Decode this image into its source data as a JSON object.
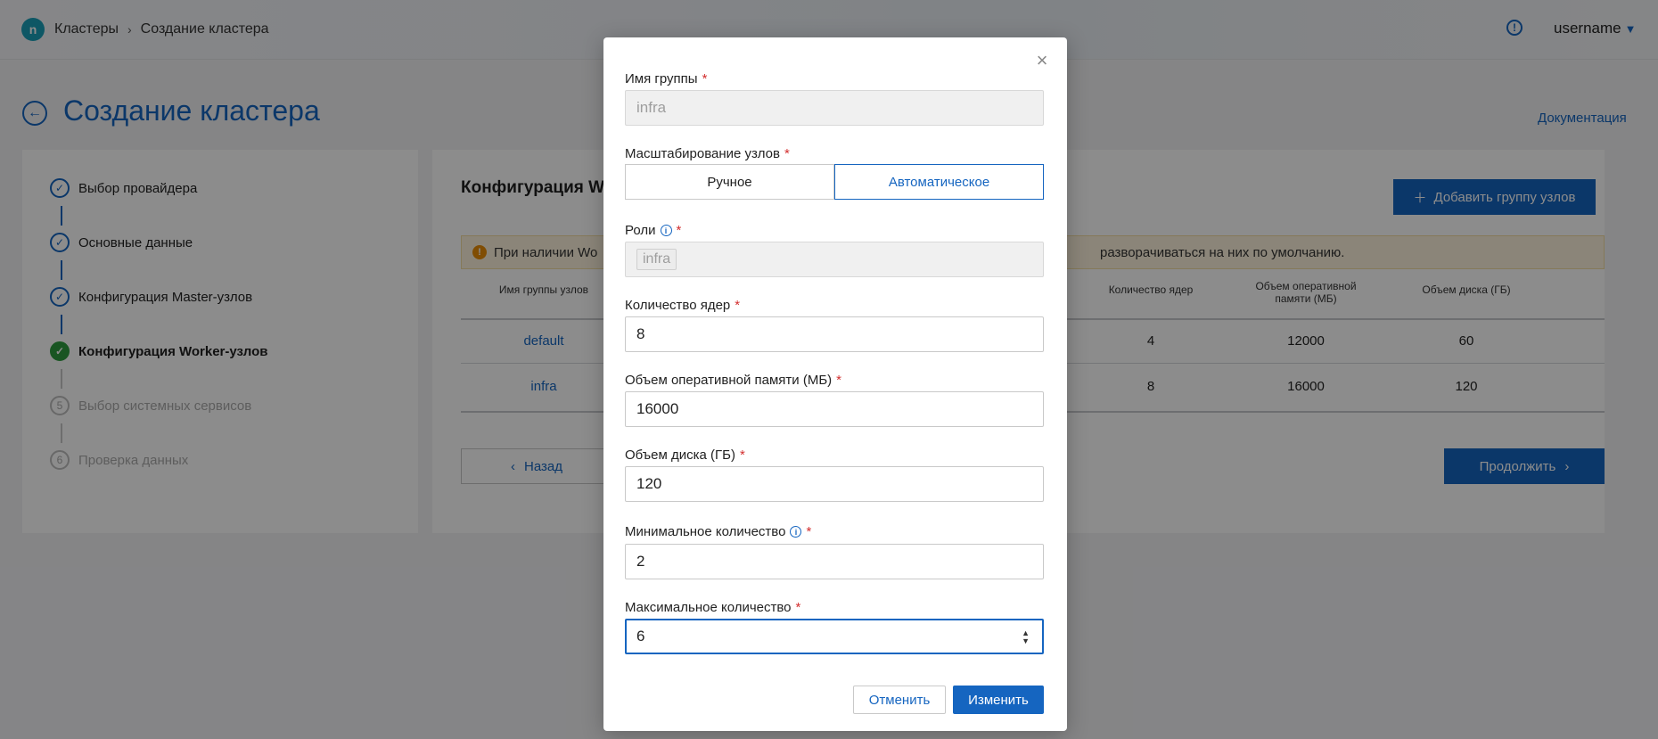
{
  "header": {
    "breadcrumbs": [
      "Кластеры",
      "Создание кластера"
    ],
    "separator": "›",
    "username": "username",
    "help_icon": "info-circle-icon"
  },
  "page": {
    "title": "Создание кластера",
    "doc_link": "Документация"
  },
  "steps": [
    {
      "number": "✓",
      "label": "Выбор провайдера",
      "state": "done"
    },
    {
      "number": "✓",
      "label": "Основные данные",
      "state": "done"
    },
    {
      "number": "✓",
      "label": "Конфигурация Master-узлов",
      "state": "done"
    },
    {
      "number": "✓",
      "label": "Конфигурация Worker-узлов",
      "state": "active"
    },
    {
      "number": "5",
      "label": "Выбор системных сервисов",
      "state": "pending"
    },
    {
      "number": "6",
      "label": "Проверка данных",
      "state": "pending"
    }
  ],
  "main": {
    "title": "Конфигурация Wo",
    "add_button": "Добавить группу узлов",
    "warning_left": "При наличии Wo",
    "warning_right": "разворачиваться на них по умолчанию.",
    "warning_icon": "!",
    "table": {
      "headers": [
        "Имя группы узлов",
        "Количество ядер",
        "Объем оперативной памяти (МБ)",
        "Объем диска (ГБ)"
      ],
      "rows": [
        {
          "name": "default",
          "cores": "4",
          "ram": "12000",
          "disk": "60"
        },
        {
          "name": "infra",
          "cores": "8",
          "ram": "16000",
          "disk": "120"
        }
      ]
    },
    "back_button": "Назад",
    "continue_button": "Продолжить"
  },
  "modal": {
    "close": "×",
    "group_name_label": "Имя группы",
    "group_name_value": "infra",
    "scaling_label": "Масштабирование узлов",
    "scaling_options": [
      "Ручное",
      "Автоматическое"
    ],
    "scaling_selected": "Автоматическое",
    "roles_label": "Роли",
    "roles_chip": "infra",
    "cores_label": "Количество ядер",
    "cores_value": "8",
    "ram_label": "Объем оперативной памяти (МБ)",
    "ram_value": "16000",
    "disk_label": "Объем диска (ГБ)",
    "disk_value": "120",
    "min_label": "Минимальное количество",
    "min_value": "2",
    "max_label": "Максимальное количество",
    "max_value": "6",
    "cancel_button": "Отменить",
    "submit_button": "Изменить",
    "required_mark": "*",
    "colors": {
      "accent": "#1565c0",
      "required": "#d32f2f",
      "step_done": "#2e9b3e",
      "warning_bg": "#fdf3dc"
    }
  }
}
